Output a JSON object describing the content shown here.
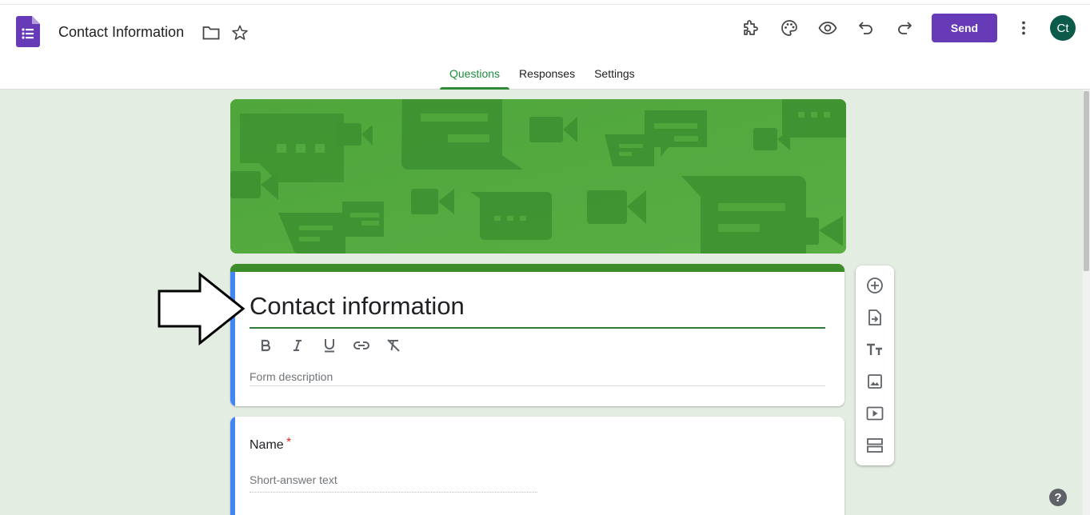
{
  "header": {
    "doc_title": "Contact Information",
    "send_label": "Send",
    "avatar_initials": "Ct",
    "icons": [
      "forms-logo-icon",
      "folder-icon",
      "star-icon",
      "addons-icon",
      "palette-icon",
      "preview-eye-icon",
      "undo-icon",
      "redo-icon",
      "more-vert-icon"
    ]
  },
  "tabs": [
    {
      "label": "Questions",
      "active": true
    },
    {
      "label": "Responses",
      "active": false
    },
    {
      "label": "Settings",
      "active": false
    }
  ],
  "form": {
    "title": "Contact information",
    "description_placeholder": "Form description",
    "format_tools": [
      "bold-icon",
      "italic-icon",
      "underline-icon",
      "link-icon",
      "clear-format-icon"
    ]
  },
  "question": {
    "title": "Name",
    "required_mark": "*",
    "answer_placeholder": "Short-answer text"
  },
  "side_toolbar": [
    "add-question-icon",
    "import-questions-icon",
    "add-title-icon",
    "add-image-icon",
    "add-video-icon",
    "add-section-icon"
  ],
  "help_label": "?",
  "colors": {
    "accent_purple": "#673ab7",
    "theme_green": "#3d8c2b",
    "background": "#e4ede2",
    "focus_blue": "#4285f4",
    "required_red": "#d93025"
  }
}
